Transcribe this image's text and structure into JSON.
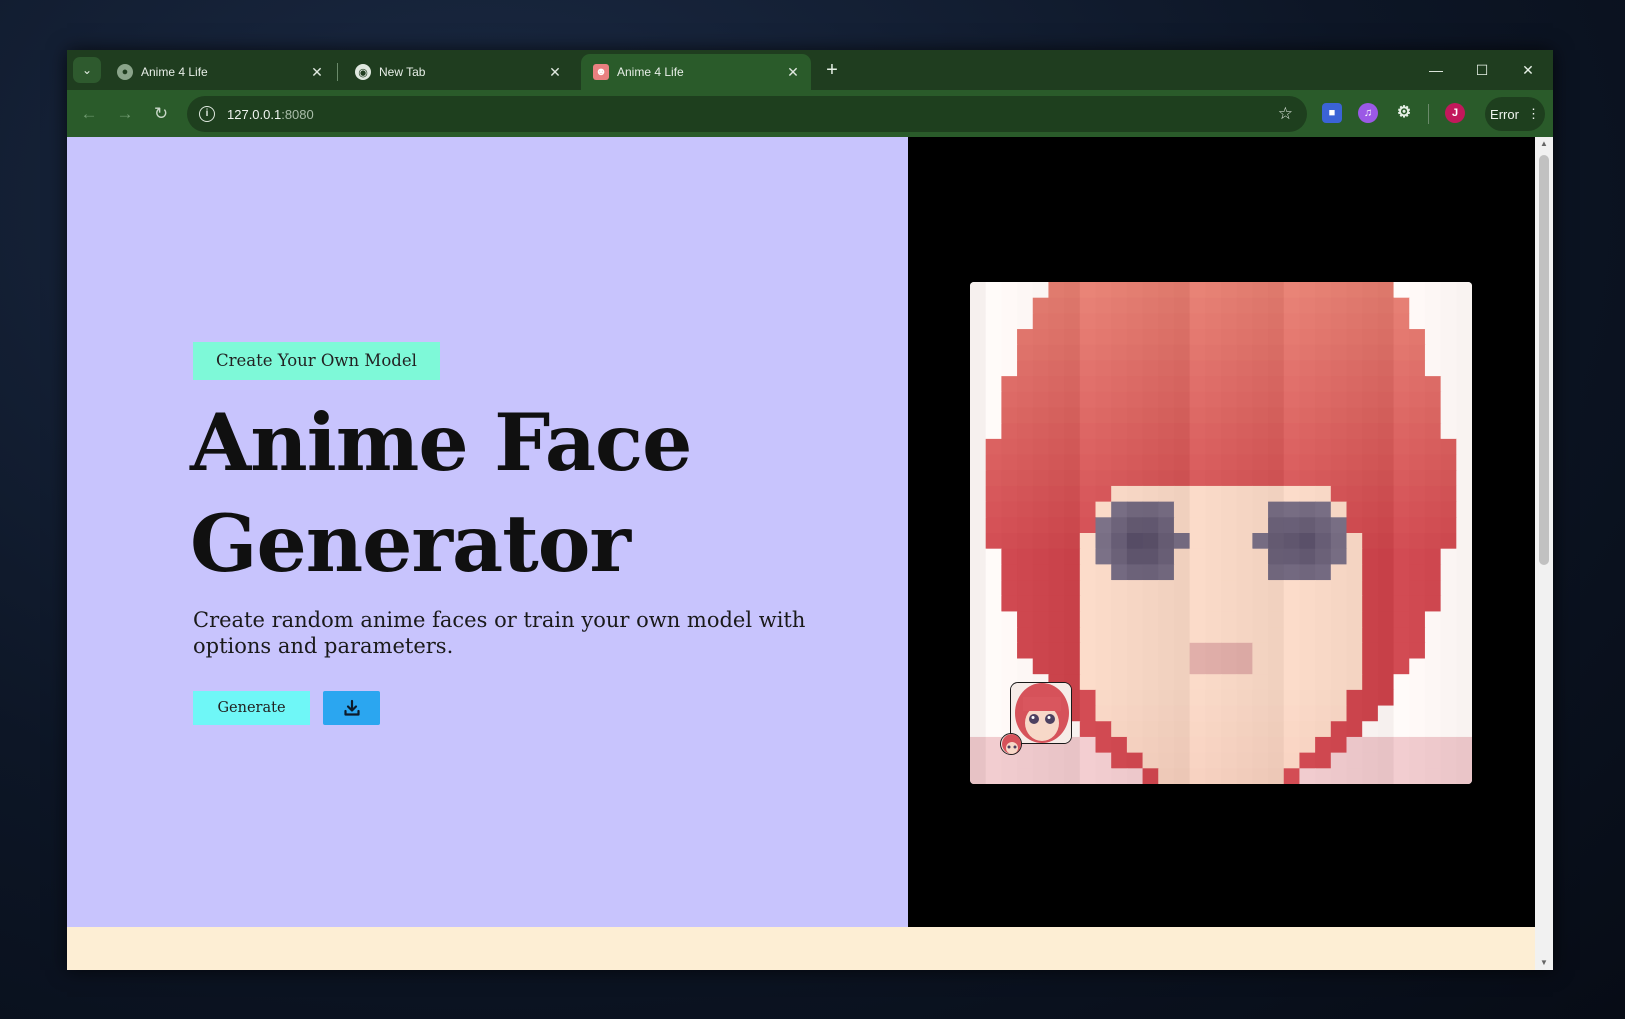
{
  "browser": {
    "tabs": [
      {
        "title": "Anime 4 Life",
        "active": false,
        "favicon": "globe-icon"
      },
      {
        "title": "New Tab",
        "active": false,
        "favicon": "chrome-icon"
      },
      {
        "title": "Anime 4 Life",
        "active": true,
        "favicon": "anime-icon"
      }
    ],
    "address": {
      "host": "127.0.0.1",
      "port": ":8080"
    },
    "profile_initial": "J",
    "error_label": "Error"
  },
  "hero": {
    "tag_label": "Create Your Own Model",
    "title_line1": "Anime Face",
    "title_line2": "Generator",
    "subtitle": "Create random anime faces or train your own model with options and parameters.",
    "generate_label": "Generate",
    "download_icon": "download-icon"
  },
  "colors": {
    "left_panel_bg": "#c8c4fd",
    "pill_bg": "#7ef9d8",
    "generate_bg": "#6ff7f7",
    "download_bg": "#2ba6f0",
    "footer_bg": "#fdeed4",
    "browser_frame": "#2a5b2a"
  }
}
